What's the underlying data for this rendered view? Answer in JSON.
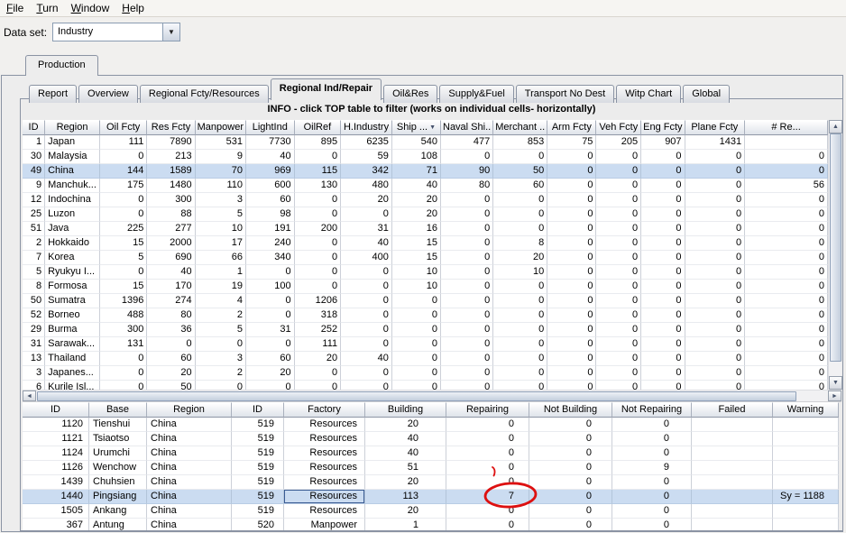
{
  "menu": {
    "items": [
      "File",
      "Turn",
      "Window",
      "Help"
    ]
  },
  "dataset": {
    "label": "Data set:",
    "value": "Industry"
  },
  "outer_tab": {
    "label": "Production"
  },
  "inner_tabs": [
    {
      "label": "Report"
    },
    {
      "label": "Overview"
    },
    {
      "label": "Regional Fcty/Resources"
    },
    {
      "label": "Regional Ind/Repair",
      "selected": true
    },
    {
      "label": "Oil&Res"
    },
    {
      "label": "Supply&Fuel"
    },
    {
      "label": "Transport No Dest"
    },
    {
      "label": "Witp Chart"
    },
    {
      "label": "Global"
    }
  ],
  "info_banner": "INFO - click TOP table to filter (works on individual cells- horizontally)",
  "top_table": {
    "columns": [
      "ID",
      "Region",
      "Oil Fcty",
      "Res Fcty",
      "Manpower",
      "LightInd",
      "OilRef",
      "H.Industry",
      "Ship ...",
      "Naval Shi..",
      "Merchant ..",
      "Arm Fcty",
      "Veh Fcty",
      "Eng Fcty",
      "Plane Fcty",
      "# Re..."
    ],
    "sort_column_index": 8,
    "selected_index": 2,
    "rows": [
      [
        "1",
        "Japan",
        "111",
        "7890",
        "531",
        "7730",
        "895",
        "6235",
        "540",
        "477",
        "853",
        "75",
        "205",
        "907",
        "1431",
        ""
      ],
      [
        "30",
        "Malaysia",
        "0",
        "213",
        "9",
        "40",
        "0",
        "59",
        "108",
        "0",
        "0",
        "0",
        "0",
        "0",
        "0",
        "0"
      ],
      [
        "49",
        "China",
        "144",
        "1589",
        "70",
        "969",
        "115",
        "342",
        "71",
        "90",
        "50",
        "0",
        "0",
        "0",
        "0",
        "0"
      ],
      [
        "9",
        "Manchuk...",
        "175",
        "1480",
        "110",
        "600",
        "130",
        "480",
        "40",
        "80",
        "60",
        "0",
        "0",
        "0",
        "0",
        "56"
      ],
      [
        "12",
        "Indochina",
        "0",
        "300",
        "3",
        "60",
        "0",
        "20",
        "20",
        "0",
        "0",
        "0",
        "0",
        "0",
        "0",
        "0"
      ],
      [
        "25",
        "Luzon",
        "0",
        "88",
        "5",
        "98",
        "0",
        "0",
        "20",
        "0",
        "0",
        "0",
        "0",
        "0",
        "0",
        "0"
      ],
      [
        "51",
        "Java",
        "225",
        "277",
        "10",
        "191",
        "200",
        "31",
        "16",
        "0",
        "0",
        "0",
        "0",
        "0",
        "0",
        "0"
      ],
      [
        "2",
        "Hokkaido",
        "15",
        "2000",
        "17",
        "240",
        "0",
        "40",
        "15",
        "0",
        "8",
        "0",
        "0",
        "0",
        "0",
        "0"
      ],
      [
        "7",
        "Korea",
        "5",
        "690",
        "66",
        "340",
        "0",
        "400",
        "15",
        "0",
        "20",
        "0",
        "0",
        "0",
        "0",
        "0"
      ],
      [
        "5",
        "Ryukyu I...",
        "0",
        "40",
        "1",
        "0",
        "0",
        "0",
        "10",
        "0",
        "10",
        "0",
        "0",
        "0",
        "0",
        "0"
      ],
      [
        "8",
        "Formosa",
        "15",
        "170",
        "19",
        "100",
        "0",
        "0",
        "10",
        "0",
        "0",
        "0",
        "0",
        "0",
        "0",
        "0"
      ],
      [
        "50",
        "Sumatra",
        "1396",
        "274",
        "4",
        "0",
        "1206",
        "0",
        "0",
        "0",
        "0",
        "0",
        "0",
        "0",
        "0",
        "0"
      ],
      [
        "52",
        "Borneo",
        "488",
        "80",
        "2",
        "0",
        "318",
        "0",
        "0",
        "0",
        "0",
        "0",
        "0",
        "0",
        "0",
        "0"
      ],
      [
        "29",
        "Burma",
        "300",
        "36",
        "5",
        "31",
        "252",
        "0",
        "0",
        "0",
        "0",
        "0",
        "0",
        "0",
        "0",
        "0"
      ],
      [
        "31",
        "Sarawak...",
        "131",
        "0",
        "0",
        "0",
        "111",
        "0",
        "0",
        "0",
        "0",
        "0",
        "0",
        "0",
        "0",
        "0"
      ],
      [
        "13",
        "Thailand",
        "0",
        "60",
        "3",
        "60",
        "20",
        "40",
        "0",
        "0",
        "0",
        "0",
        "0",
        "0",
        "0",
        "0"
      ],
      [
        "3",
        "Japanes...",
        "0",
        "20",
        "2",
        "20",
        "0",
        "0",
        "0",
        "0",
        "0",
        "0",
        "0",
        "0",
        "0",
        "0"
      ],
      [
        "6",
        "Kurile Isl...",
        "0",
        "50",
        "0",
        "0",
        "0",
        "0",
        "0",
        "0",
        "0",
        "0",
        "0",
        "0",
        "0",
        "0"
      ]
    ]
  },
  "bottom_table": {
    "columns": [
      "ID",
      "Base",
      "Region",
      "ID",
      "Factory",
      "Building",
      "Repairing",
      "Not Building",
      "Not Repairing",
      "Failed",
      "Warning"
    ],
    "selected_index": 5,
    "rows": [
      [
        "1120",
        "Tienshui",
        "China",
        "519",
        "Resources",
        "20",
        "0",
        "0",
        "0",
        "",
        ""
      ],
      [
        "1121",
        "Tsiaotso",
        "China",
        "519",
        "Resources",
        "40",
        "0",
        "0",
        "0",
        "",
        ""
      ],
      [
        "1124",
        "Urumchi",
        "China",
        "519",
        "Resources",
        "40",
        "0",
        "0",
        "0",
        "",
        ""
      ],
      [
        "1126",
        "Wenchow",
        "China",
        "519",
        "Resources",
        "51",
        "0",
        "0",
        "9",
        "",
        ""
      ],
      [
        "1439",
        "Chuhsien",
        "China",
        "519",
        "Resources",
        "20",
        "0",
        "0",
        "0",
        "",
        ""
      ],
      [
        "1440",
        "Pingsiang",
        "China",
        "519",
        "Resources",
        "113",
        "7",
        "0",
        "0",
        "",
        "Sy = 1188"
      ],
      [
        "1505",
        "Ankang",
        "China",
        "519",
        "Resources",
        "20",
        "0",
        "0",
        "0",
        "",
        ""
      ],
      [
        "367",
        "Antung",
        "China",
        "520",
        "Manpower",
        "1",
        "0",
        "0",
        "0",
        "",
        ""
      ]
    ]
  },
  "annotations": {
    "highlight_color": "#dd1010",
    "circled_value": "7"
  }
}
